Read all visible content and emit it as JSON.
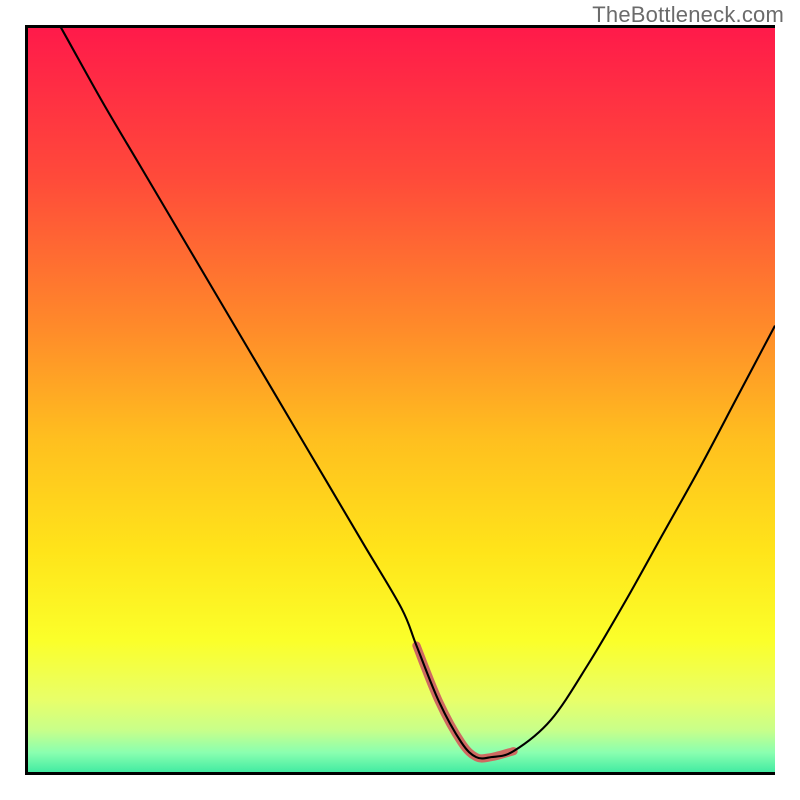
{
  "attribution": "TheBottleneck.com",
  "chart_data": {
    "type": "line",
    "title": "",
    "xlabel": "",
    "ylabel": "",
    "xlim": [
      0,
      100
    ],
    "ylim": [
      0,
      100
    ],
    "x": [
      0,
      5,
      10,
      15,
      20,
      25,
      30,
      35,
      40,
      45,
      50,
      52,
      55,
      58,
      60,
      62,
      65,
      70,
      75,
      80,
      85,
      90,
      95,
      100
    ],
    "values": [
      108,
      99,
      90,
      81.5,
      73,
      64.5,
      56,
      47.5,
      39,
      30.5,
      22,
      17,
      9.5,
      4,
      2,
      2,
      2.8,
      7,
      14.5,
      23,
      32,
      41,
      50.5,
      60
    ],
    "series": [
      {
        "name": "bottleneck-curve",
        "color": "#000000"
      }
    ],
    "trough_region": {
      "x_start": 52,
      "x_end": 65,
      "color": "#cf6a61"
    },
    "background_gradient": {
      "stops": [
        {
          "offset": 0.0,
          "color": "#ff1a4a"
        },
        {
          "offset": 0.2,
          "color": "#ff4a3a"
        },
        {
          "offset": 0.4,
          "color": "#ff8a2a"
        },
        {
          "offset": 0.55,
          "color": "#ffbf1f"
        },
        {
          "offset": 0.7,
          "color": "#ffe41a"
        },
        {
          "offset": 0.82,
          "color": "#fbff2a"
        },
        {
          "offset": 0.9,
          "color": "#e8ff6a"
        },
        {
          "offset": 0.94,
          "color": "#c8ff8a"
        },
        {
          "offset": 0.97,
          "color": "#8affb0"
        },
        {
          "offset": 1.0,
          "color": "#38e8a0"
        }
      ]
    }
  }
}
